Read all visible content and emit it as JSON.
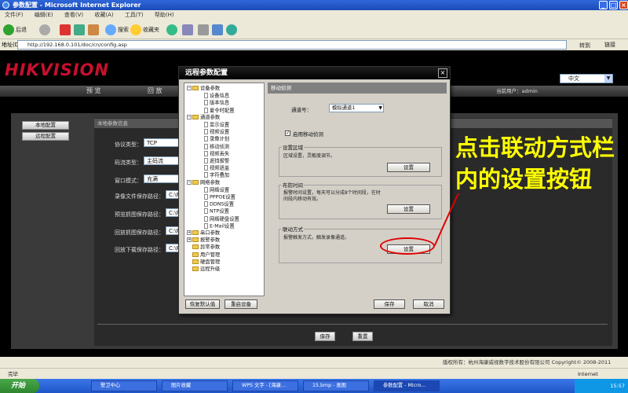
{
  "browser": {
    "title": "参数配置 - Microsoft Internet Explorer",
    "menu": [
      "文件(F)",
      "编辑(E)",
      "查看(V)",
      "收藏(A)",
      "工具(T)",
      "帮助(H)"
    ],
    "toolbar": {
      "back": "后退",
      "search": "搜索",
      "favorites": "收藏夹"
    },
    "address_label": "地址(D)",
    "address": "http://192.168.0.101/doc/cn/config.asp",
    "go": "转到",
    "links": "链接",
    "status": "完毕",
    "zone": "Internet"
  },
  "page": {
    "logo": "HIKVISION",
    "nav": [
      "预 览",
      "回 放"
    ],
    "current_user": "当前用户：admin",
    "language": "中文",
    "side_buttons": [
      "本地配置",
      "远程配置"
    ],
    "section_title": "本地参数信息",
    "form": [
      {
        "label": "协议类型：",
        "value": "TCP"
      },
      {
        "label": "码流类型：",
        "value": "主码流"
      },
      {
        "label": "窗口模式：",
        "value": "充满"
      },
      {
        "label": "录像文件保存路径：",
        "value": "C:\\P"
      },
      {
        "label": "预览抓图保存路径：",
        "value": "C:\\P"
      },
      {
        "label": "回放抓图保存路径：",
        "value": "C:\\P"
      },
      {
        "label": "回放下载保存路径：",
        "value": "C:\\P"
      }
    ],
    "save": "保存",
    "reset": "重置",
    "copyright": "版权所有：杭州海康威视数字技术股份有限公司 Copyright© 2008-2011"
  },
  "dialog": {
    "title": "远程参数配置",
    "tree": [
      {
        "label": "设备参数",
        "type": "folder",
        "level": 0,
        "expanded": true
      },
      {
        "label": "设备信息",
        "type": "doc",
        "level": 1
      },
      {
        "label": "版本信息",
        "type": "doc",
        "level": 1
      },
      {
        "label": "夏令时配置",
        "type": "doc",
        "level": 1
      },
      {
        "label": "通道参数",
        "type": "folder",
        "level": 0,
        "expanded": true
      },
      {
        "label": "显示设置",
        "type": "doc",
        "level": 1
      },
      {
        "label": "视频设置",
        "type": "doc",
        "level": 1
      },
      {
        "label": "录像计划",
        "type": "doc",
        "level": 1
      },
      {
        "label": "移动侦测",
        "type": "doc",
        "level": 1
      },
      {
        "label": "视频丢失",
        "type": "doc",
        "level": 1
      },
      {
        "label": "遮挡报警",
        "type": "doc",
        "level": 1
      },
      {
        "label": "视频遮盖",
        "type": "doc",
        "level": 1
      },
      {
        "label": "字符叠加",
        "type": "doc",
        "level": 1
      },
      {
        "label": "网络参数",
        "type": "folder",
        "level": 0,
        "expanded": true
      },
      {
        "label": "网络设置",
        "type": "doc",
        "level": 1
      },
      {
        "label": "PPPOE设置",
        "type": "doc",
        "level": 1
      },
      {
        "label": "DDNS设置",
        "type": "doc",
        "level": 1
      },
      {
        "label": "NTP设置",
        "type": "doc",
        "level": 1
      },
      {
        "label": "网络硬盘设置",
        "type": "doc",
        "level": 1
      },
      {
        "label": "E-Mail设置",
        "type": "doc",
        "level": 1
      },
      {
        "label": "串口参数",
        "type": "folder",
        "level": 0,
        "expanded": false
      },
      {
        "label": "报警参数",
        "type": "folder",
        "level": 0,
        "expanded": false
      },
      {
        "label": "异常参数",
        "type": "folder",
        "level": 0
      },
      {
        "label": "用户管理",
        "type": "folder",
        "level": 0
      },
      {
        "label": "硬盘管理",
        "type": "folder",
        "level": 0
      },
      {
        "label": "远程升级",
        "type": "folder",
        "level": 0
      }
    ],
    "pane_title": "移动侦测",
    "channel_label": "通道号：",
    "channel_value": "模拟通道1",
    "enable_label": "启用移动侦测",
    "enable_checked": true,
    "groups": [
      {
        "title": "设置区域",
        "desc": "区域设置，灵敏度调节。",
        "button": "设置"
      },
      {
        "title": "布防时间",
        "desc": "报警时间设置，每天可以分成8个时间段，在时间段内移动有效。",
        "button": "设置"
      },
      {
        "title": "联动方式",
        "desc": "报警触发方式，触发录像通道。",
        "button": "设置"
      }
    ],
    "restore": "恢复默认值",
    "restart": "重启设备",
    "save": "保存",
    "cancel": "取消"
  },
  "annotation": "点击联动方式栏内的设置按钮",
  "taskbar": {
    "start": "开始",
    "tasks": [
      "警卫中心",
      "图片收藏",
      "WPS 文字 - [海康...",
      "15.bmp - 画图",
      "参数配置 - Micro..."
    ],
    "time": "15:57"
  },
  "colors": {
    "brand": "#c8102e",
    "annotation": "#ffff00",
    "highlight": "#e00000"
  }
}
